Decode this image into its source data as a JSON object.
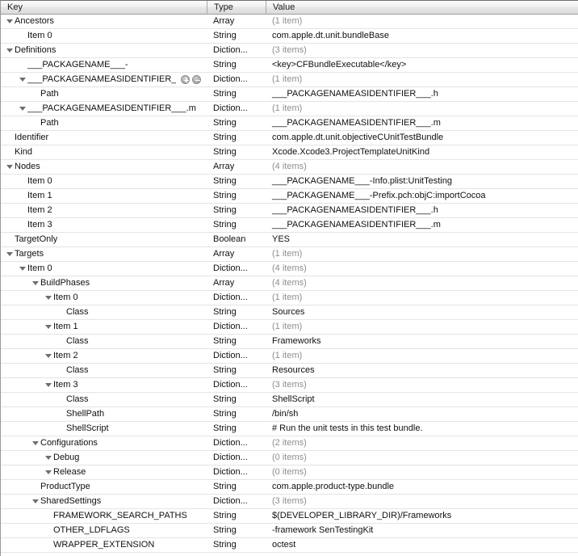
{
  "header": {
    "key": "Key",
    "type": "Type",
    "value": "Value"
  },
  "colors": {
    "row_text": "#101010",
    "muted_text": "#8e8e8e",
    "row_separator": "#e4e4e4",
    "header_border": "#9c9c9c"
  },
  "rows": [
    {
      "indent": 0,
      "disclosure": "open",
      "key": "Ancestors",
      "type": "Array",
      "value": "(1 item)",
      "muted": true
    },
    {
      "indent": 1,
      "disclosure": "none",
      "key": "Item 0",
      "type": "String",
      "value": "com.apple.dt.unit.bundleBase",
      "muted": false
    },
    {
      "indent": 0,
      "disclosure": "open",
      "key": "Definitions",
      "type": "Diction...",
      "value": "(3 items)",
      "muted": true
    },
    {
      "indent": 1,
      "disclosure": "none",
      "key": "___PACKAGENAME___-",
      "type": "String",
      "value": "<key>CFBundleExecutable</key>",
      "muted": false
    },
    {
      "indent": 1,
      "disclosure": "open",
      "key": "___PACKAGENAMEASIDENTIFIER_",
      "type": "Diction...",
      "value": "(1 item)",
      "muted": true,
      "buttons": true
    },
    {
      "indent": 2,
      "disclosure": "none",
      "key": "Path",
      "type": "String",
      "value": "___PACKAGENAMEASIDENTIFIER___.h",
      "muted": false
    },
    {
      "indent": 1,
      "disclosure": "open",
      "key": "___PACKAGENAMEASIDENTIFIER___.m",
      "type": "Diction...",
      "value": "(1 item)",
      "muted": true
    },
    {
      "indent": 2,
      "disclosure": "none",
      "key": "Path",
      "type": "String",
      "value": "___PACKAGENAMEASIDENTIFIER___.m",
      "muted": false
    },
    {
      "indent": 0,
      "disclosure": "none",
      "key": "Identifier",
      "type": "String",
      "value": "com.apple.dt.unit.objectiveCUnitTestBundle",
      "muted": false
    },
    {
      "indent": 0,
      "disclosure": "none",
      "key": "Kind",
      "type": "String",
      "value": "Xcode.Xcode3.ProjectTemplateUnitKind",
      "muted": false
    },
    {
      "indent": 0,
      "disclosure": "open",
      "key": "Nodes",
      "type": "Array",
      "value": "(4 items)",
      "muted": true
    },
    {
      "indent": 1,
      "disclosure": "none",
      "key": "Item 0",
      "type": "String",
      "value": "___PACKAGENAME___-Info.plist:UnitTesting",
      "muted": false
    },
    {
      "indent": 1,
      "disclosure": "none",
      "key": "Item 1",
      "type": "String",
      "value": "___PACKAGENAME___-Prefix.pch:objC:importCocoa",
      "muted": false
    },
    {
      "indent": 1,
      "disclosure": "none",
      "key": "Item 2",
      "type": "String",
      "value": "___PACKAGENAMEASIDENTIFIER___.h",
      "muted": false
    },
    {
      "indent": 1,
      "disclosure": "none",
      "key": "Item 3",
      "type": "String",
      "value": "___PACKAGENAMEASIDENTIFIER___.m",
      "muted": false
    },
    {
      "indent": 0,
      "disclosure": "none",
      "key": "TargetOnly",
      "type": "Boolean",
      "value": "YES",
      "muted": false
    },
    {
      "indent": 0,
      "disclosure": "open",
      "key": "Targets",
      "type": "Array",
      "value": "(1 item)",
      "muted": true
    },
    {
      "indent": 1,
      "disclosure": "open",
      "key": "Item 0",
      "type": "Diction...",
      "value": "(4 items)",
      "muted": true
    },
    {
      "indent": 2,
      "disclosure": "open",
      "key": "BuildPhases",
      "type": "Array",
      "value": "(4 items)",
      "muted": true
    },
    {
      "indent": 3,
      "disclosure": "open",
      "key": "Item 0",
      "type": "Diction...",
      "value": "(1 item)",
      "muted": true
    },
    {
      "indent": 4,
      "disclosure": "none",
      "key": "Class",
      "type": "String",
      "value": "Sources",
      "muted": false
    },
    {
      "indent": 3,
      "disclosure": "open",
      "key": "Item 1",
      "type": "Diction...",
      "value": "(1 item)",
      "muted": true
    },
    {
      "indent": 4,
      "disclosure": "none",
      "key": "Class",
      "type": "String",
      "value": "Frameworks",
      "muted": false
    },
    {
      "indent": 3,
      "disclosure": "open",
      "key": "Item 2",
      "type": "Diction...",
      "value": "(1 item)",
      "muted": true
    },
    {
      "indent": 4,
      "disclosure": "none",
      "key": "Class",
      "type": "String",
      "value": "Resources",
      "muted": false
    },
    {
      "indent": 3,
      "disclosure": "open",
      "key": "Item 3",
      "type": "Diction...",
      "value": "(3 items)",
      "muted": true
    },
    {
      "indent": 4,
      "disclosure": "none",
      "key": "Class",
      "type": "String",
      "value": "ShellScript",
      "muted": false
    },
    {
      "indent": 4,
      "disclosure": "none",
      "key": "ShellPath",
      "type": "String",
      "value": "/bin/sh",
      "muted": false
    },
    {
      "indent": 4,
      "disclosure": "none",
      "key": "ShellScript",
      "type": "String",
      "value": "# Run the unit tests in this test bundle.",
      "muted": false
    },
    {
      "indent": 2,
      "disclosure": "open",
      "key": "Configurations",
      "type": "Diction...",
      "value": "(2 items)",
      "muted": true
    },
    {
      "indent": 3,
      "disclosure": "open",
      "key": "Debug",
      "type": "Diction...",
      "value": "(0 items)",
      "muted": true
    },
    {
      "indent": 3,
      "disclosure": "open",
      "key": "Release",
      "type": "Diction...",
      "value": "(0 items)",
      "muted": true
    },
    {
      "indent": 2,
      "disclosure": "none",
      "key": "ProductType",
      "type": "String",
      "value": "com.apple.product-type.bundle",
      "muted": false
    },
    {
      "indent": 2,
      "disclosure": "open",
      "key": "SharedSettings",
      "type": "Diction...",
      "value": "(3 items)",
      "muted": true
    },
    {
      "indent": 3,
      "disclosure": "none",
      "key": "FRAMEWORK_SEARCH_PATHS",
      "type": "String",
      "value": "$(DEVELOPER_LIBRARY_DIR)/Frameworks",
      "muted": false
    },
    {
      "indent": 3,
      "disclosure": "none",
      "key": "OTHER_LDFLAGS",
      "type": "String",
      "value": "-framework SenTestingKit",
      "muted": false
    },
    {
      "indent": 3,
      "disclosure": "none",
      "key": "WRAPPER_EXTENSION",
      "type": "String",
      "value": "octest",
      "muted": false
    }
  ],
  "row_buttons": {
    "add_label": "+",
    "remove_label": "-"
  }
}
